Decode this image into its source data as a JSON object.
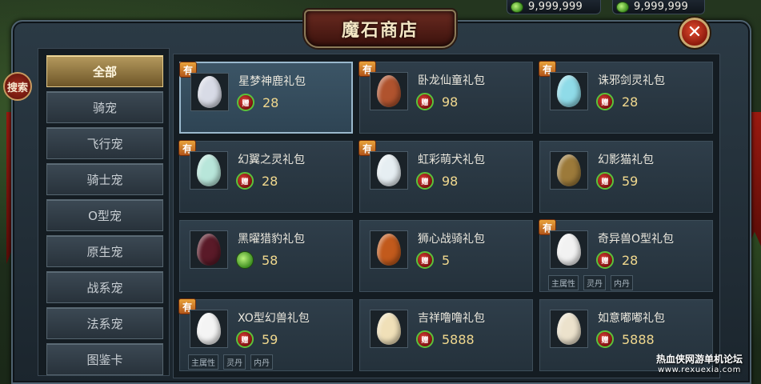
{
  "currency": [
    {
      "amount": "9,999,999",
      "icon": "green-gem-icon"
    },
    {
      "amount": "9,999,999",
      "icon": "green-gem-icon"
    }
  ],
  "title": "魔石商店",
  "close_label": "✕",
  "search_label": "搜索",
  "categories": [
    "全部",
    "骑宠",
    "飞行宠",
    "骑士宠",
    "O型宠",
    "原生宠",
    "战系宠",
    "法系宠",
    "图鉴卡"
  ],
  "active_category": "全部",
  "badge_label": "有",
  "items": [
    {
      "name": "星梦神鹿礼包",
      "price": "28",
      "badge": true,
      "currency": "bound",
      "egg": "#d8dbe6",
      "selected": true
    },
    {
      "name": "卧龙仙童礼包",
      "price": "98",
      "badge": true,
      "currency": "bound",
      "egg": "#b0532e"
    },
    {
      "name": "诛邪剑灵礼包",
      "price": "28",
      "badge": true,
      "currency": "bound",
      "egg": "#8fdbe8"
    },
    {
      "name": "幻翼之灵礼包",
      "price": "28",
      "badge": true,
      "currency": "bound",
      "egg": "#b8e6da"
    },
    {
      "name": "虹彩萌犬礼包",
      "price": "98",
      "badge": true,
      "currency": "bound",
      "egg": "#e6eef2"
    },
    {
      "name": "幻影猫礼包",
      "price": "59",
      "badge": false,
      "currency": "bound",
      "egg": "#9c7a3a"
    },
    {
      "name": "黑曜猎豹礼包",
      "price": "58",
      "badge": false,
      "currency": "gem",
      "egg": "#5a1a28"
    },
    {
      "name": "狮心战骑礼包",
      "price": "5",
      "badge": false,
      "currency": "bound",
      "egg": "#c25a1c"
    },
    {
      "name": "奇异兽O型礼包",
      "price": "28",
      "badge": true,
      "currency": "bound",
      "egg": "#f2f2f2",
      "tags": [
        "主属性",
        "灵丹",
        "内丹"
      ]
    },
    {
      "name": "XO型幻兽礼包",
      "price": "59",
      "badge": true,
      "currency": "bound",
      "egg": "#f4f4f4",
      "tags": [
        "主属性",
        "灵丹",
        "内丹"
      ]
    },
    {
      "name": "吉祥噜噜礼包",
      "price": "5888",
      "badge": false,
      "currency": "bound",
      "egg": "#f0e0b8"
    },
    {
      "name": "如意嘟嘟礼包",
      "price": "5888",
      "badge": false,
      "currency": "bound",
      "egg": "#ece2cc"
    }
  ],
  "bound_icon_label": "赠",
  "watermark": {
    "line1": "热血侠网游单机论坛",
    "line2": "www.rexuexia.com"
  }
}
